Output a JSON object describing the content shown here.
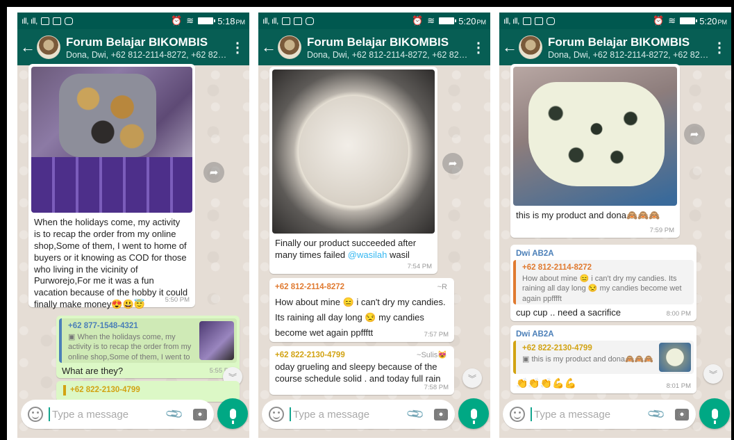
{
  "status": {
    "signal": "ıll, ıll,",
    "phone1_time": "5:18",
    "phone2_time": "5:20",
    "phone3_time": "5:20",
    "ampm": "PM"
  },
  "chat": {
    "title": "Forum Belajar BIKOMBIS",
    "subtitle": "Dona, Dwi, +62 812-2114-8272, +62 821-...",
    "back_icon": "arrow-left-icon",
    "menu_icon": "more-vert-icon"
  },
  "composer": {
    "placeholder": "Type a message",
    "emoji_icon": "emoji-icon",
    "attach_icon": "paperclip-icon",
    "camera_icon": "camera-icon",
    "mic_icon": "mic-icon"
  },
  "phone1": {
    "msg1": {
      "text": "When the holidays come, my activity is to recap the order from my online shop,Some of them, I went to home of buyers or it knowing as COD for those who living in the vicinity of Purworejo,For me it was a fun vacation because of the hobby it could finally make money",
      "emojis": "😍😃😇",
      "time": "5:50 PM"
    },
    "msg2": {
      "quote_sender": "+62 877-1548-4321",
      "quote_text": "When the holidays come, my activity is to recap the order from my online shop,Some of them, I went to",
      "text": "What are they?",
      "time": "5:55 PM"
    },
    "msg3": {
      "sender": "+62 822-2130-4799"
    }
  },
  "phone2": {
    "msg1": {
      "text": "Finally our product succeeded after many times failed",
      "mention": "@wasilah",
      "text_after": " wasil",
      "time": "7:54 PM"
    },
    "msg2": {
      "sender": "+62 812-2114-8272",
      "sender_alias": "~R",
      "text_a": "How about mine ",
      "emoji_a": "😑",
      "text_b": " i can't dry my candies. Its raining all day long ",
      "emoji_b": "😒",
      "text_c": " my candies become wet again ppffftt",
      "time": "7:57 PM"
    },
    "msg3": {
      "sender": "+62 822-2130-4799",
      "sender_alias": "~Sulis😻",
      "text": "oday grueling and sleepy because of the course schedule solid . and today full rain",
      "time": "7:58 PM"
    }
  },
  "phone3": {
    "msg1": {
      "text": "this is my product and dona",
      "emojis": "🙈🙈🙈",
      "time": "7:59 PM"
    },
    "msg2": {
      "sender": "Dwi AB2A",
      "quote_sender": "+62 812-2114-8272",
      "quote_text": "How about mine 😑 i can't dry my candies. Its raining all day long 😒 my candies become wet again ppfffft",
      "text": "cup cup .. need a sacrifice",
      "time": "8:00 PM"
    },
    "msg3": {
      "sender": "Dwi AB2A",
      "quote_sender": "+62 822-2130-4799",
      "quote_text": "this is my product and dona🙈🙈🙈",
      "emojis": "👏👏👏💪💪",
      "time": "8:01 PM"
    }
  },
  "colors": {
    "appbar": "#075e54",
    "statusbar": "#00584f",
    "outgoing": "#dcf8c6",
    "sender_orange": "#e07a30",
    "sender_blue": "#4b7fb8",
    "sender_gold": "#d2a313",
    "mic": "#00a884"
  }
}
